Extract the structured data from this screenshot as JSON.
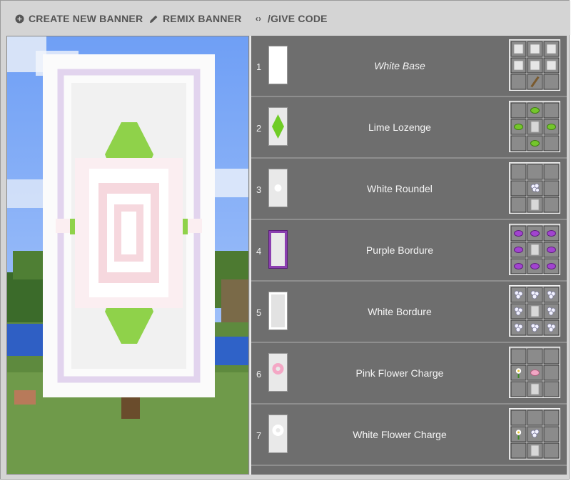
{
  "toolbar": {
    "create_label": "CREATE NEW BANNER",
    "remix_label": "REMIX BANNER",
    "give_label": "/GIVE CODE"
  },
  "colors": {
    "panel_bg": "#6e6e6e",
    "toolbar_bg": "#d4d4d4",
    "lime": "#7ccc2e",
    "purple": "#8b3fb0",
    "pink": "#f0a0c0",
    "white": "#ffffff"
  },
  "steps": [
    {
      "number": "1",
      "name": "White Base",
      "italic": true,
      "thumb_icon": "white-base-icon",
      "recipe": "wool-and-stick-recipe"
    },
    {
      "number": "2",
      "name": "Lime Lozenge",
      "thumb_icon": "lime-lozenge-icon",
      "recipe": "lime-dye-lozenge-recipe"
    },
    {
      "number": "3",
      "name": "White Roundel",
      "thumb_icon": "white-roundel-icon",
      "recipe": "bone-meal-roundel-recipe"
    },
    {
      "number": "4",
      "name": "Purple Bordure",
      "thumb_icon": "purple-bordure-icon",
      "recipe": "purple-dye-bordure-recipe"
    },
    {
      "number": "5",
      "name": "White Bordure",
      "thumb_icon": "white-bordure-icon",
      "recipe": "bone-meal-bordure-recipe"
    },
    {
      "number": "6",
      "name": "Pink Flower Charge",
      "thumb_icon": "pink-flower-charge-icon",
      "recipe": "oxeye-daisy-pink-dye-recipe"
    },
    {
      "number": "7",
      "name": "White Flower Charge",
      "thumb_icon": "white-flower-charge-icon",
      "recipe": "oxeye-daisy-bone-meal-recipe"
    }
  ]
}
